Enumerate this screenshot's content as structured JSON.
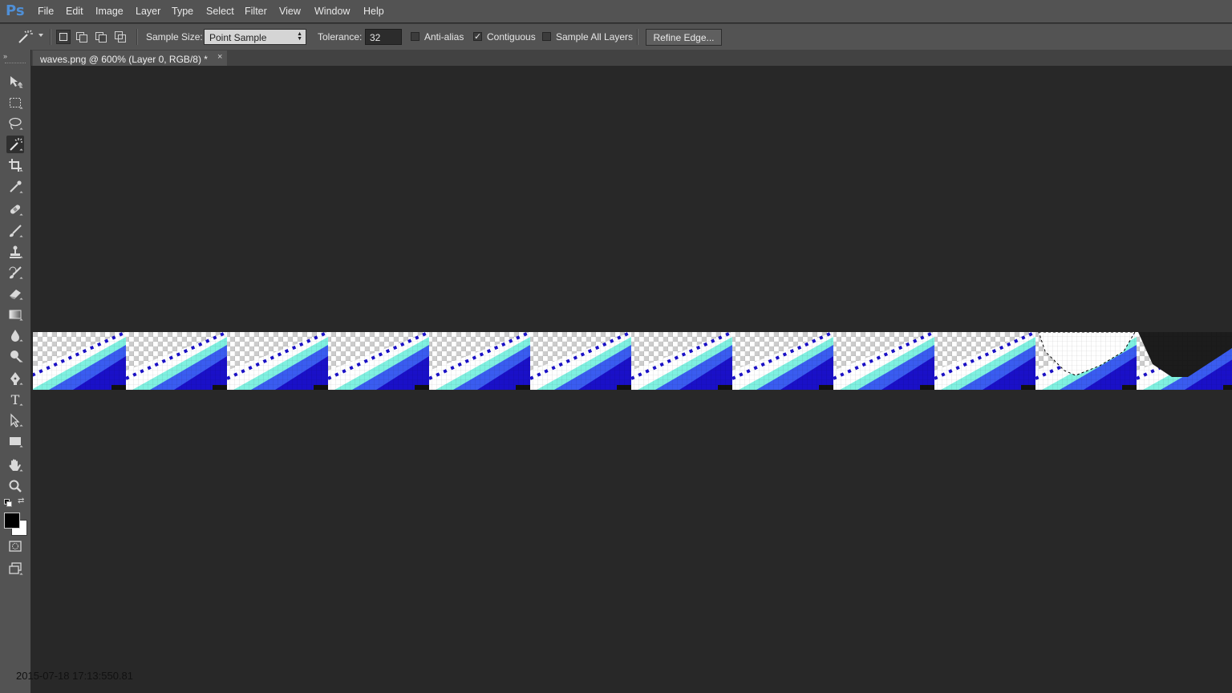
{
  "app": {
    "logo": "Ps"
  },
  "menu": [
    "File",
    "Edit",
    "Image",
    "Layer",
    "Type",
    "Select",
    "Filter",
    "View",
    "Window",
    "Help"
  ],
  "options": {
    "tool_icon": "magic-wand-icon",
    "sample_size_label": "Sample Size:",
    "sample_size_value": "Point Sample",
    "tolerance_label": "Tolerance:",
    "tolerance_value": "32",
    "anti_alias_label": "Anti-alias",
    "anti_alias_checked": false,
    "contiguous_label": "Contiguous",
    "contiguous_checked": true,
    "sample_all_layers_label": "Sample All Layers",
    "sample_all_layers_checked": false,
    "refine_edge_label": "Refine Edge..."
  },
  "document": {
    "tab_title": "waves.png @ 600% (Layer 0, RGB/8) *",
    "close_glyph": "×"
  },
  "colors": {
    "wave_dark": "#1a10c8",
    "wave_mid": "#3a5cf0",
    "wave_foam": "#7ff0e0",
    "foreground": "#000000",
    "background": "#ffffff"
  },
  "tools": [
    "move",
    "marquee",
    "lasso",
    "magic-wand",
    "crop",
    "eyedropper",
    "healing-brush",
    "brush",
    "clone-stamp",
    "history-brush",
    "eraser",
    "gradient",
    "blur",
    "dodge",
    "pen",
    "type",
    "path-selection",
    "rectangle",
    "hand",
    "zoom"
  ],
  "timestamp": "2015-07-18 17:13:550.81"
}
